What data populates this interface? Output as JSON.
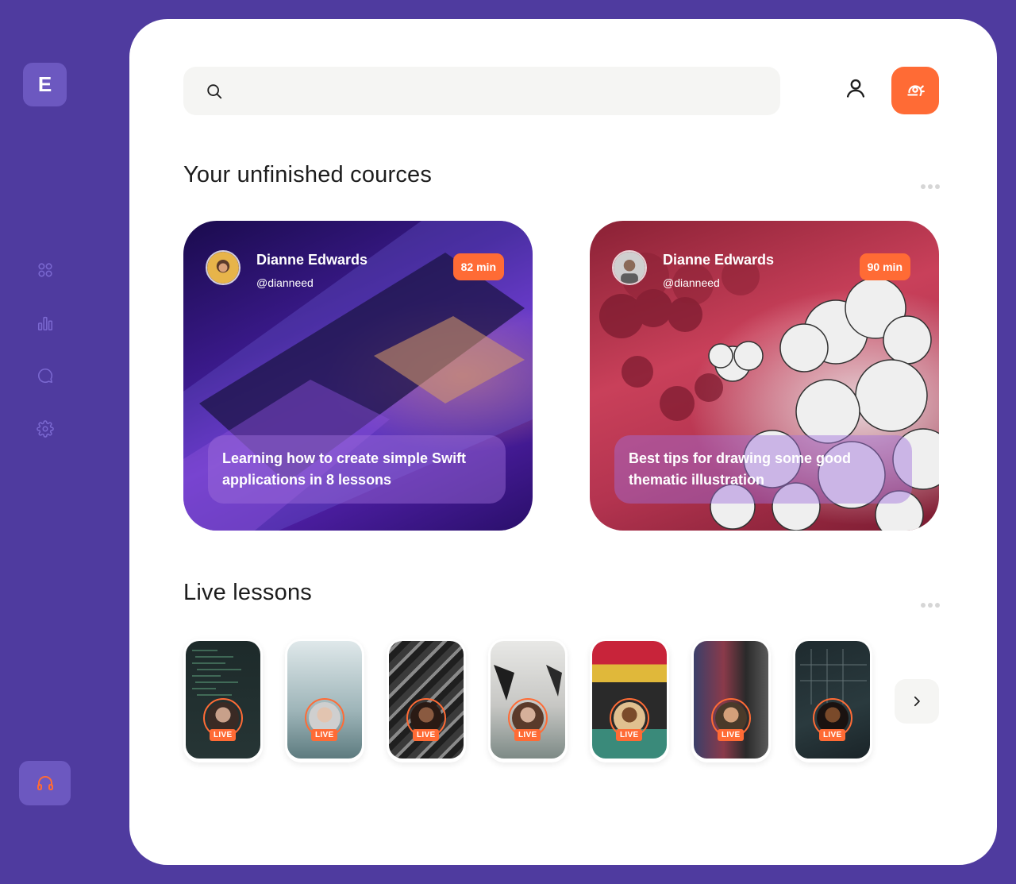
{
  "sidebar": {
    "logo_letter": "E",
    "icons": [
      "grid-icon",
      "bar-chart-icon",
      "chat-icon",
      "settings-icon"
    ],
    "support_icon": "headphones-icon"
  },
  "search": {
    "placeholder": ""
  },
  "header": {
    "user_icon": "user-icon",
    "notification_icon": "bell-icon"
  },
  "courses": {
    "title": "Your unfinished cources",
    "items": [
      {
        "author": "Dianne Edwards",
        "handle": "@dianneed",
        "duration": "82 min",
        "title": "Learning how to create simple Swift applications in 8 lessons"
      },
      {
        "author": "Dianne Edwards",
        "handle": "@dianneed",
        "duration": "90 min",
        "title": "Best tips for drawing some good thematic illustration"
      }
    ]
  },
  "live": {
    "title": "Live lessons",
    "badge": "LIVE",
    "count": 7
  },
  "colors": {
    "background": "#4f3b9f",
    "accent": "#ff6b35",
    "panel": "#ffffff",
    "sidebar_tile": "#6c58c0"
  }
}
